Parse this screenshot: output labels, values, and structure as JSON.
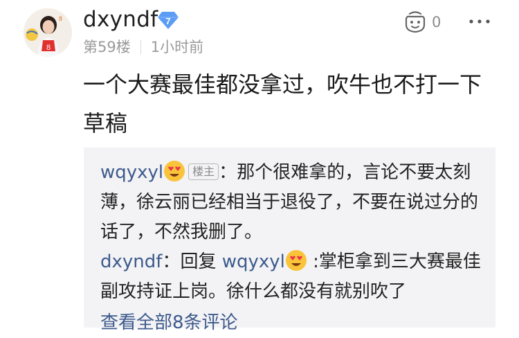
{
  "post": {
    "username": "dxyndf",
    "level": "7",
    "floor": "第59楼",
    "time": "1小时前",
    "like_count": "0",
    "content": "一个大赛最佳都没拿过，吹牛也不打一下草稿"
  },
  "replies": [
    {
      "name": "wqyxyl",
      "owner_tag": "楼主",
      "colon": "：",
      "text": "那个很难拿的，言论不要太刻薄，徐云丽已经相当于退役了，不要在说过分的话了，不然我删了。"
    },
    {
      "name": "dxyndf",
      "colon": "：",
      "reply_word": "回复",
      "target": "wqyxyl",
      "text": ":掌柜拿到三大赛最佳副攻持证上岗。徐什么都没有就别吹了"
    }
  ],
  "view_all": "查看全部8条评论",
  "colors": {
    "link_blue": "#3d5a8c",
    "badge_blue": "#5b9cf5",
    "reply_bg": "#f3f3f5"
  },
  "icons": {
    "emoji": "heart-eyes-emoji",
    "like": "like-icon",
    "more": "more-dots-icon",
    "level": "level-diamond-icon"
  }
}
